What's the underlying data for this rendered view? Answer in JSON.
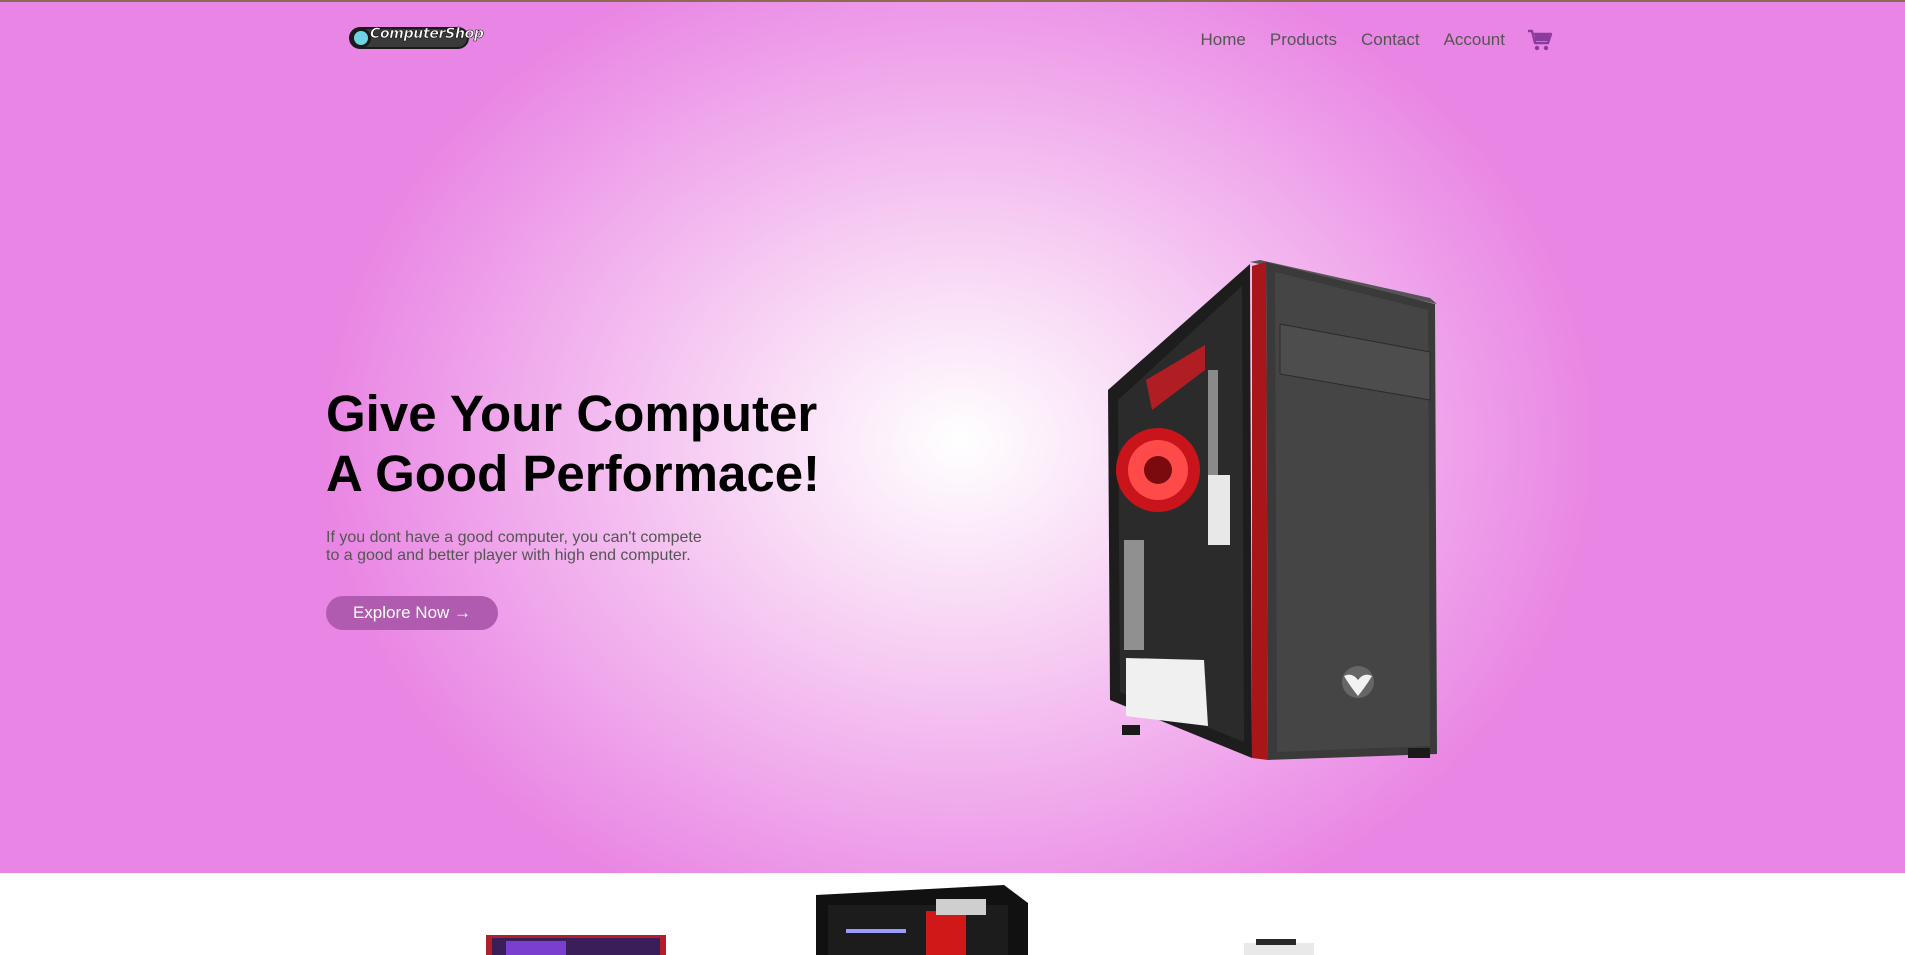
{
  "brand": {
    "logo_text": "ComputerShop"
  },
  "nav": {
    "items": [
      "Home",
      "Products",
      "Contact",
      "Account"
    ],
    "cart_icon": "cart-icon"
  },
  "hero": {
    "headline_line1": "Give Your Computer",
    "headline_line2": "A Good Performace!",
    "sub_line1": "If you dont have a good computer, you can't compete",
    "sub_line2": "to a good and better player with high end computer.",
    "cta_label": "Explore Now →"
  },
  "colors": {
    "hero_edge": "#e985e4",
    "hero_center": "#ffffff",
    "cta_bg": "#b05bb0",
    "cart": "#8b3a9e",
    "nav_text": "#555555"
  }
}
